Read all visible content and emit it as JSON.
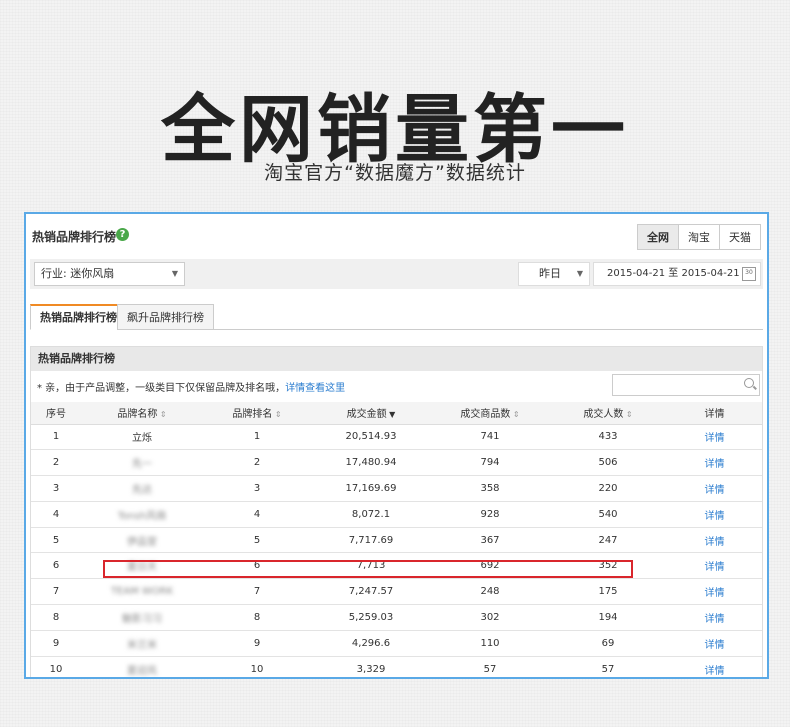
{
  "hero": {
    "title": "全网销量第一",
    "subtitle": "淘宝官方“数据魔方”数据统计"
  },
  "panel": {
    "title": "热销品牌排行榜",
    "range_tabs": [
      "全网",
      "淘宝",
      "天猫"
    ],
    "active_range": "全网",
    "industry_label": "行业: 迷你风扇",
    "period": "昨日",
    "date_range": "2015-04-21 至 2015-04-21",
    "subtabs": [
      "热销品牌排行榜",
      "飙升品牌排行榜"
    ],
    "table_title": "热销品牌排行榜",
    "notice_text": "* 亲，由于产品调整，一级类目下仅保留品牌及排名哦，",
    "notice_link": "详情查看这里",
    "columns": [
      "序号",
      "品牌名称",
      "品牌排名",
      "成交金额",
      "成交商品数",
      "成交人数",
      "详情"
    ],
    "rows": [
      {
        "idx": "1",
        "brand": "立烁",
        "rank": "1",
        "amount": "20,514.93",
        "items": "741",
        "buyers": "433",
        "detail": "详情"
      },
      {
        "idx": "2",
        "brand": "先一",
        "rank": "2",
        "amount": "17,480.94",
        "items": "794",
        "buyers": "506",
        "detail": "详情"
      },
      {
        "idx": "3",
        "brand": "先达",
        "rank": "3",
        "amount": "17,169.69",
        "items": "358",
        "buyers": "220",
        "detail": "详情"
      },
      {
        "idx": "4",
        "brand": "Tonsh风扇",
        "rank": "4",
        "amount": "8,072.1",
        "items": "928",
        "buyers": "540",
        "detail": "详情"
      },
      {
        "idx": "5",
        "brand": "伊品堂",
        "rank": "5",
        "amount": "7,717.69",
        "items": "367",
        "buyers": "247",
        "detail": "详情"
      },
      {
        "idx": "6",
        "brand": "夏日天",
        "rank": "6",
        "amount": "7,713",
        "items": "692",
        "buyers": "352",
        "detail": "详情"
      },
      {
        "idx": "7",
        "brand": "TEAM WORK",
        "rank": "7",
        "amount": "7,247.57",
        "items": "248",
        "buyers": "175",
        "detail": "详情"
      },
      {
        "idx": "8",
        "brand": "魅影习习",
        "rank": "8",
        "amount": "5,259.03",
        "items": "302",
        "buyers": "194",
        "detail": "详情"
      },
      {
        "idx": "9",
        "brand": "米兰米",
        "rank": "9",
        "amount": "4,296.6",
        "items": "110",
        "buyers": "69",
        "detail": "详情"
      },
      {
        "idx": "10",
        "brand": "夏迎风",
        "rank": "10",
        "amount": "3,329",
        "items": "57",
        "buyers": "57",
        "detail": "详情"
      }
    ]
  }
}
